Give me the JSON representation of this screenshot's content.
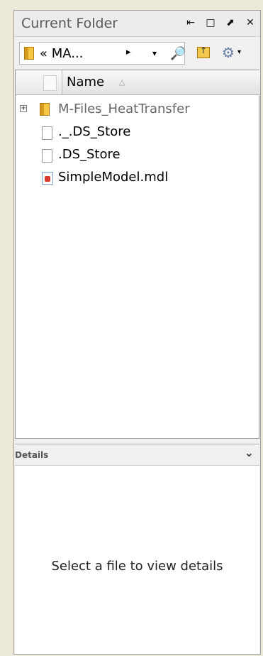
{
  "panel": {
    "title": "Current Folder",
    "buttons": [
      "undock",
      "maximize",
      "minimize",
      "close"
    ]
  },
  "toolbar": {
    "address_text": "« MA...",
    "address_arrow": "▸",
    "dropdown_glyph": "▾",
    "search_icon": "🔎",
    "settings_icon": "⚙",
    "settings_dropdown": "▾"
  },
  "list": {
    "header": {
      "name": "Name",
      "sort_glyph": "△"
    },
    "items": [
      {
        "label": "M-Files_HeatTransfer",
        "type": "folder",
        "expander": "+"
      },
      {
        "label": "._.DS_Store",
        "type": "file"
      },
      {
        "label": ".DS_Store",
        "type": "file"
      },
      {
        "label": "SimpleModel.mdl",
        "type": "model"
      }
    ]
  },
  "details": {
    "label": "Details",
    "chevron": "⌄",
    "message": "Select a file to view details"
  },
  "colors": {
    "panel_bg": "#f0f0f0",
    "list_bg": "#ffffff",
    "folder_item_text": "#666666",
    "accent_search": "#1c6fd1"
  }
}
